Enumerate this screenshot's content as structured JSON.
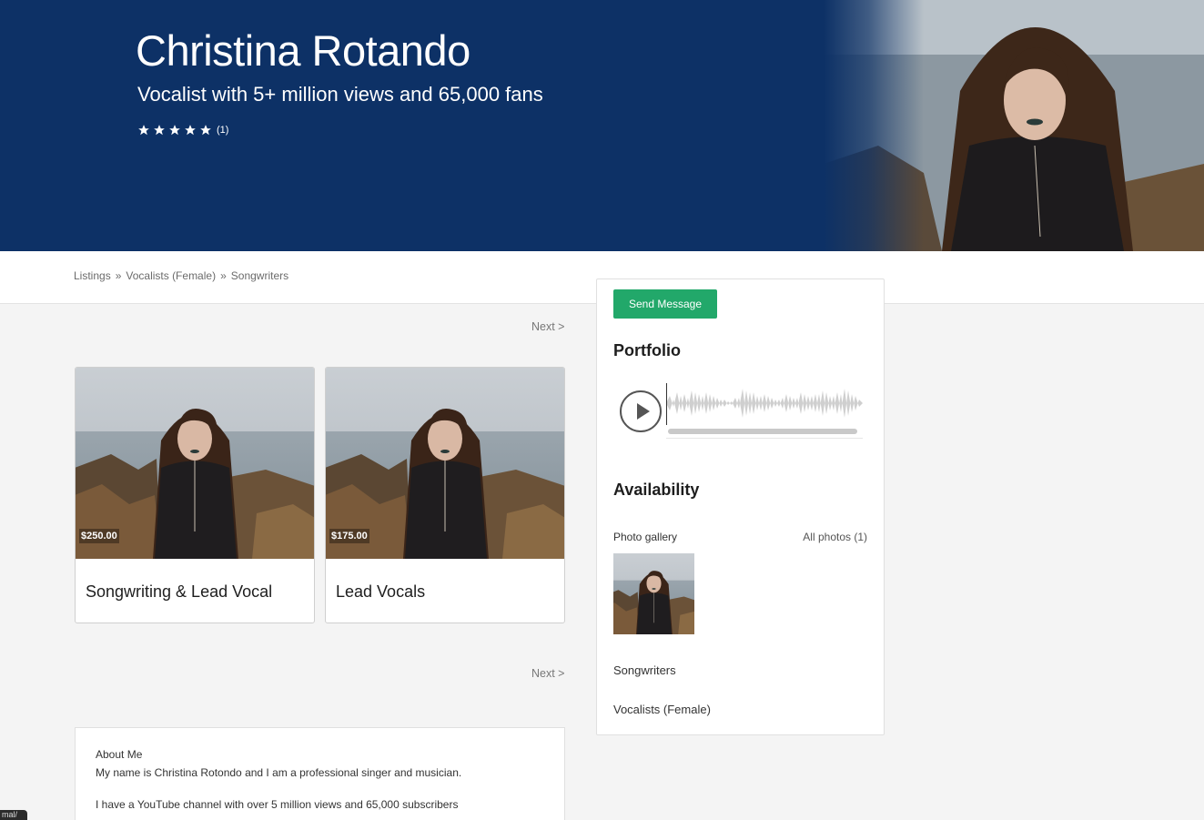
{
  "hero": {
    "name": "Christina Rotando",
    "tagline": "Vocalist with 5+ million views and 65,000 fans",
    "rating_stars": 5,
    "rating_count": "(1)",
    "background_color": "#0d3166"
  },
  "breadcrumb": {
    "items": [
      "Listings",
      "Vocalists (Female)",
      "Songwriters"
    ],
    "separator": "»"
  },
  "pagination": {
    "next_label": "Next >"
  },
  "listings": [
    {
      "price": "$250.00",
      "title": "Songwriting & Lead Vocal"
    },
    {
      "price": "$175.00",
      "title": "Lead Vocals"
    }
  ],
  "about": {
    "heading": "About Me",
    "lines": [
      "My name is Christina Rotondo and I am a professional singer and musician.",
      "I have a YouTube channel with over 5 million views and 65,000 subscribers"
    ]
  },
  "sidebar": {
    "send_message_label": "Send Message",
    "accent_color": "#22a86a",
    "portfolio_heading": "Portfolio",
    "availability_heading": "Availability",
    "gallery_label": "Photo gallery",
    "gallery_all_label": "All photos (1)",
    "categories": [
      "Songwriters",
      "Vocalists (Female)"
    ]
  },
  "icons": {
    "rating": "star-icon",
    "player": "play-icon"
  },
  "corner_tab": "mal/"
}
